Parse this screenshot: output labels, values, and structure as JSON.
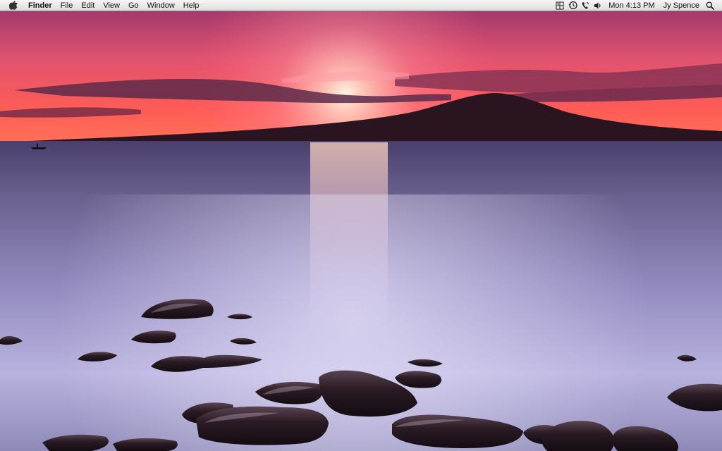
{
  "menubar": {
    "app_name": "Finder",
    "items": [
      "File",
      "Edit",
      "View",
      "Go",
      "Window",
      "Help"
    ],
    "clock": "Mon 4:13 PM",
    "user": "Jy Spence",
    "status_icons": [
      "spaces-icon",
      "time-machine-icon",
      "phone-icon",
      "volume-icon",
      "spotlight-icon"
    ]
  },
  "colors": {
    "menubar_top": "#f6f6f6",
    "menubar_bottom": "#dcdcdc",
    "sky_top": "#a9356a",
    "sky_glow": "#ff6b6b",
    "water": "#8d86bf",
    "mountain": "#2a1420"
  }
}
